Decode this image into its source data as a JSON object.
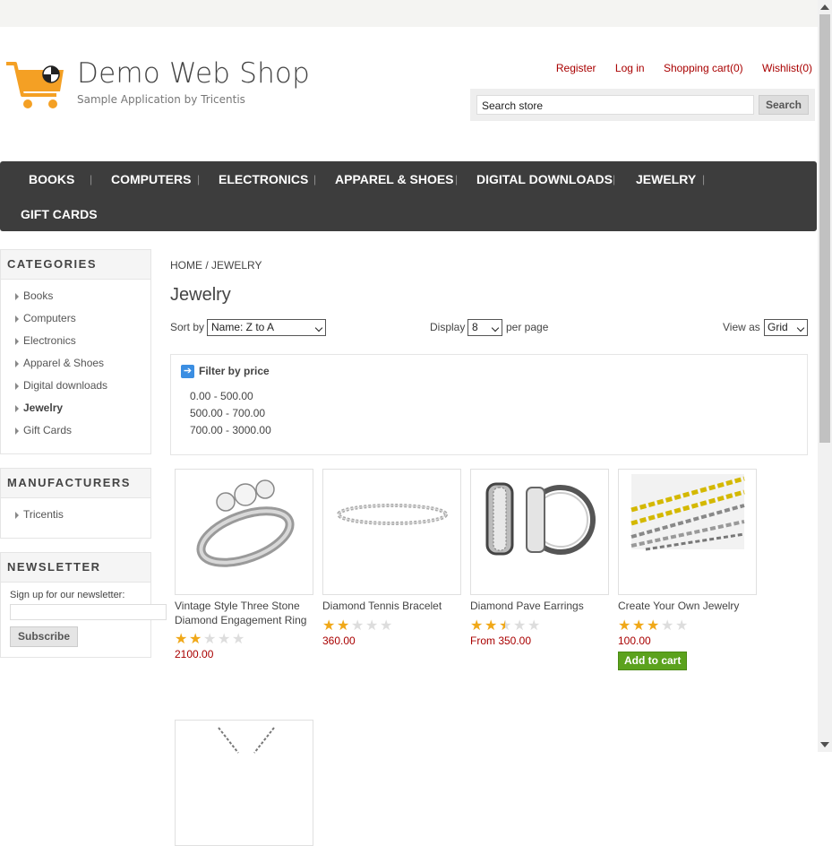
{
  "header": {
    "title": "Demo Web Shop",
    "subtitle": "Sample Application by Tricentis",
    "links": [
      "Register",
      "Log in",
      "Shopping cart(0)",
      "Wishlist(0)"
    ],
    "search_placeholder": "Search store",
    "search_button": "Search"
  },
  "menu": [
    "BOOKS",
    "COMPUTERS",
    "ELECTRONICS",
    "APPAREL & SHOES",
    "DIGITAL DOWNLOADS",
    "JEWELRY",
    "GIFT CARDS"
  ],
  "categories": {
    "title": "CATEGORIES",
    "items": [
      "Books",
      "Computers",
      "Electronics",
      "Apparel & Shoes",
      "Digital downloads",
      "Jewelry",
      "Gift Cards"
    ],
    "active": "Jewelry"
  },
  "manufacturers": {
    "title": "MANUFACTURERS",
    "items": [
      "Tricentis"
    ]
  },
  "newsletter": {
    "title": "NEWSLETTER",
    "label": "Sign up for our newsletter:",
    "button": "Subscribe"
  },
  "breadcrumb": {
    "home": "HOME",
    "separator": "/",
    "current": "JEWELRY"
  },
  "page_title": "Jewelry",
  "controls": {
    "sort_label": "Sort by",
    "sort_value": "Name: Z to A",
    "display_label": "Display",
    "display_value": "8",
    "per_page_label": "per page",
    "view_label": "View as",
    "view_value": "Grid"
  },
  "filter": {
    "title": "Filter by price",
    "options": [
      "0.00 - 500.00",
      "500.00 - 700.00",
      "700.00 - 3000.00"
    ]
  },
  "products": [
    {
      "name": "Vintage Style Three Stone Diamond Engagement Ring",
      "rating": 2,
      "price": "2100.00",
      "image": "ring"
    },
    {
      "name": "Diamond Tennis Bracelet",
      "rating": 2,
      "price": "360.00",
      "image": "bracelet"
    },
    {
      "name": "Diamond Pave Earrings",
      "rating": 2.5,
      "price": "From 350.00",
      "image": "earrings"
    },
    {
      "name": "Create Your Own Jewelry",
      "rating": 3,
      "price": "100.00",
      "image": "chains",
      "button": "Add to cart"
    }
  ],
  "colors": {
    "accent_red": "#a90000",
    "menu_bg": "#3d3d3d",
    "star": "#f0a818",
    "cart_button": "#5ba21d"
  }
}
